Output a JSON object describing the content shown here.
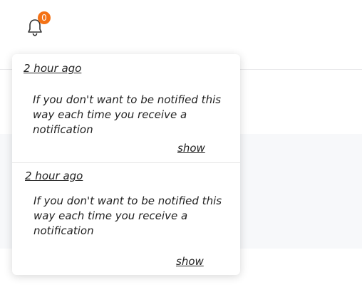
{
  "header": {
    "bell_icon": "bell-icon",
    "notification_count": "0",
    "badge_color": "#f47216"
  },
  "notifications": [
    {
      "time": "2 hour ago",
      "message": "If you don't want to be notified this way each time you receive a notification",
      "action_label": "show"
    },
    {
      "time": "2 hour ago",
      "message": "If you don't want to be notified this way each time you receive a notification",
      "action_label": "show"
    }
  ]
}
